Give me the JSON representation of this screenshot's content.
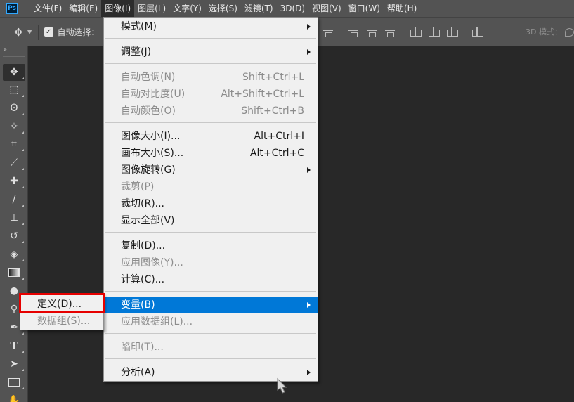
{
  "app_icon": "photoshop-logo",
  "app_logo_text": "Ps",
  "menubar": {
    "items": [
      {
        "label": "文件(F)",
        "active": false
      },
      {
        "label": "编辑(E)",
        "active": false
      },
      {
        "label": "图像(I)",
        "active": true
      },
      {
        "label": "图层(L)",
        "active": false
      },
      {
        "label": "文字(Y)",
        "active": false
      },
      {
        "label": "选择(S)",
        "active": false
      },
      {
        "label": "滤镜(T)",
        "active": false
      },
      {
        "label": "3D(D)",
        "active": false
      },
      {
        "label": "视图(V)",
        "active": false
      },
      {
        "label": "窗口(W)",
        "active": false
      },
      {
        "label": "帮助(H)",
        "active": false
      }
    ]
  },
  "options_bar": {
    "move_icon": "move-arrows-icon",
    "auto_select_checked": true,
    "auto_select_label": "自动选择：",
    "mode_3d_label": "3D 模式："
  },
  "toolbar": {
    "collapse": "»",
    "tools": [
      {
        "name": "move-tool",
        "selected": true
      },
      {
        "name": "marquee-tool",
        "selected": false
      },
      {
        "name": "lasso-tool",
        "selected": false
      },
      {
        "name": "magic-wand-tool",
        "selected": false
      },
      {
        "name": "crop-tool",
        "selected": false
      },
      {
        "name": "eyedropper-tool",
        "selected": false
      },
      {
        "name": "healing-brush-tool",
        "selected": false
      },
      {
        "name": "brush-tool",
        "selected": false
      },
      {
        "name": "clone-stamp-tool",
        "selected": false
      },
      {
        "name": "history-brush-tool",
        "selected": false
      },
      {
        "name": "eraser-tool",
        "selected": false
      },
      {
        "name": "gradient-tool",
        "selected": false
      },
      {
        "name": "blur-tool",
        "selected": false
      },
      {
        "name": "dodge-tool",
        "selected": false
      },
      {
        "name": "pen-tool",
        "selected": false
      },
      {
        "name": "type-tool",
        "selected": false
      },
      {
        "name": "path-selection-tool",
        "selected": false
      },
      {
        "name": "rectangle-tool",
        "selected": false
      },
      {
        "name": "hand-tool",
        "selected": false
      }
    ]
  },
  "image_menu": {
    "items": [
      {
        "label": "模式(M)",
        "shortcut": "",
        "submenu": true,
        "disabled": false,
        "highlight": false
      },
      {
        "label": "调整(J)",
        "shortcut": "",
        "submenu": true,
        "disabled": false,
        "highlight": false
      },
      {
        "label": "自动色调(N)",
        "shortcut": "Shift+Ctrl+L",
        "submenu": false,
        "disabled": true,
        "highlight": false
      },
      {
        "label": "自动对比度(U)",
        "shortcut": "Alt+Shift+Ctrl+L",
        "submenu": false,
        "disabled": true,
        "highlight": false
      },
      {
        "label": "自动颜色(O)",
        "shortcut": "Shift+Ctrl+B",
        "submenu": false,
        "disabled": true,
        "highlight": false
      },
      {
        "label": "图像大小(I)...",
        "shortcut": "Alt+Ctrl+I",
        "submenu": false,
        "disabled": false,
        "highlight": false
      },
      {
        "label": "画布大小(S)...",
        "shortcut": "Alt+Ctrl+C",
        "submenu": false,
        "disabled": false,
        "highlight": false
      },
      {
        "label": "图像旋转(G)",
        "shortcut": "",
        "submenu": true,
        "disabled": false,
        "highlight": false
      },
      {
        "label": "裁剪(P)",
        "shortcut": "",
        "submenu": false,
        "disabled": true,
        "highlight": false
      },
      {
        "label": "裁切(R)...",
        "shortcut": "",
        "submenu": false,
        "disabled": false,
        "highlight": false
      },
      {
        "label": "显示全部(V)",
        "shortcut": "",
        "submenu": false,
        "disabled": false,
        "highlight": false
      },
      {
        "label": "复制(D)...",
        "shortcut": "",
        "submenu": false,
        "disabled": false,
        "highlight": false
      },
      {
        "label": "应用图像(Y)...",
        "shortcut": "",
        "submenu": false,
        "disabled": true,
        "highlight": false
      },
      {
        "label": "计算(C)...",
        "shortcut": "",
        "submenu": false,
        "disabled": false,
        "highlight": false
      },
      {
        "label": "变量(B)",
        "shortcut": "",
        "submenu": true,
        "disabled": false,
        "highlight": true
      },
      {
        "label": "应用数据组(L)...",
        "shortcut": "",
        "submenu": false,
        "disabled": true,
        "highlight": false
      },
      {
        "label": "陷印(T)...",
        "shortcut": "",
        "submenu": false,
        "disabled": true,
        "highlight": false
      },
      {
        "label": "分析(A)",
        "shortcut": "",
        "submenu": true,
        "disabled": false,
        "highlight": false
      }
    ]
  },
  "variables_submenu": {
    "items": [
      {
        "label": "定义(D)...",
        "disabled": false,
        "outlined": true
      },
      {
        "label": "数据组(S)...",
        "disabled": true,
        "outlined": false
      }
    ]
  },
  "colors": {
    "highlight": "#0078d7",
    "annotation_box": "#e60000",
    "ui_panel": "#535353",
    "canvas": "#282828"
  }
}
